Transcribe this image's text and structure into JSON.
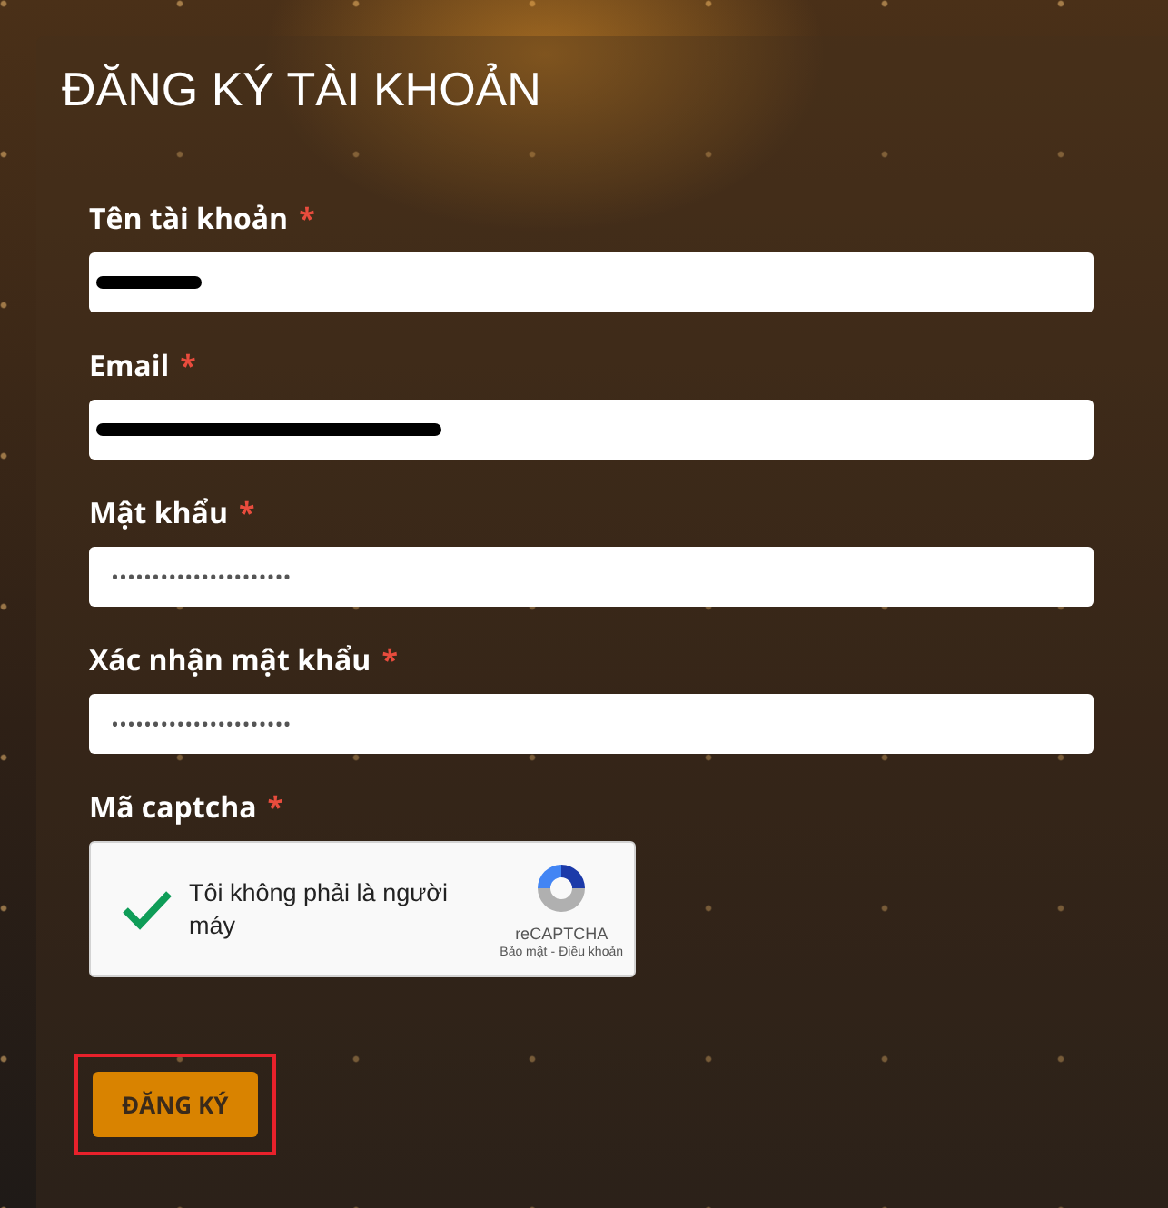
{
  "title": "ĐĂNG KÝ TÀI KHOẢN",
  "fields": [
    {
      "label": "Tên tài khoản",
      "required": true,
      "redacted": true
    },
    {
      "label": "Email",
      "required": true,
      "redacted": true
    },
    {
      "label": "Mật khẩu",
      "required": true,
      "value": "••••••••••••••••••••••"
    },
    {
      "label": "Xác nhận mật khẩu",
      "required": true,
      "value": "••••••••••••••••••••••"
    }
  ],
  "required_mark": "*",
  "captcha": {
    "label": "Mã captcha",
    "required": true,
    "checked": true,
    "text": "Tôi không phải là người máy",
    "brand": "reCAPTCHA",
    "privacy": "Bảo mật",
    "separator": "-",
    "terms": "Điều khoản"
  },
  "submit": {
    "label": "ĐĂNG KÝ",
    "highlighted": true
  }
}
